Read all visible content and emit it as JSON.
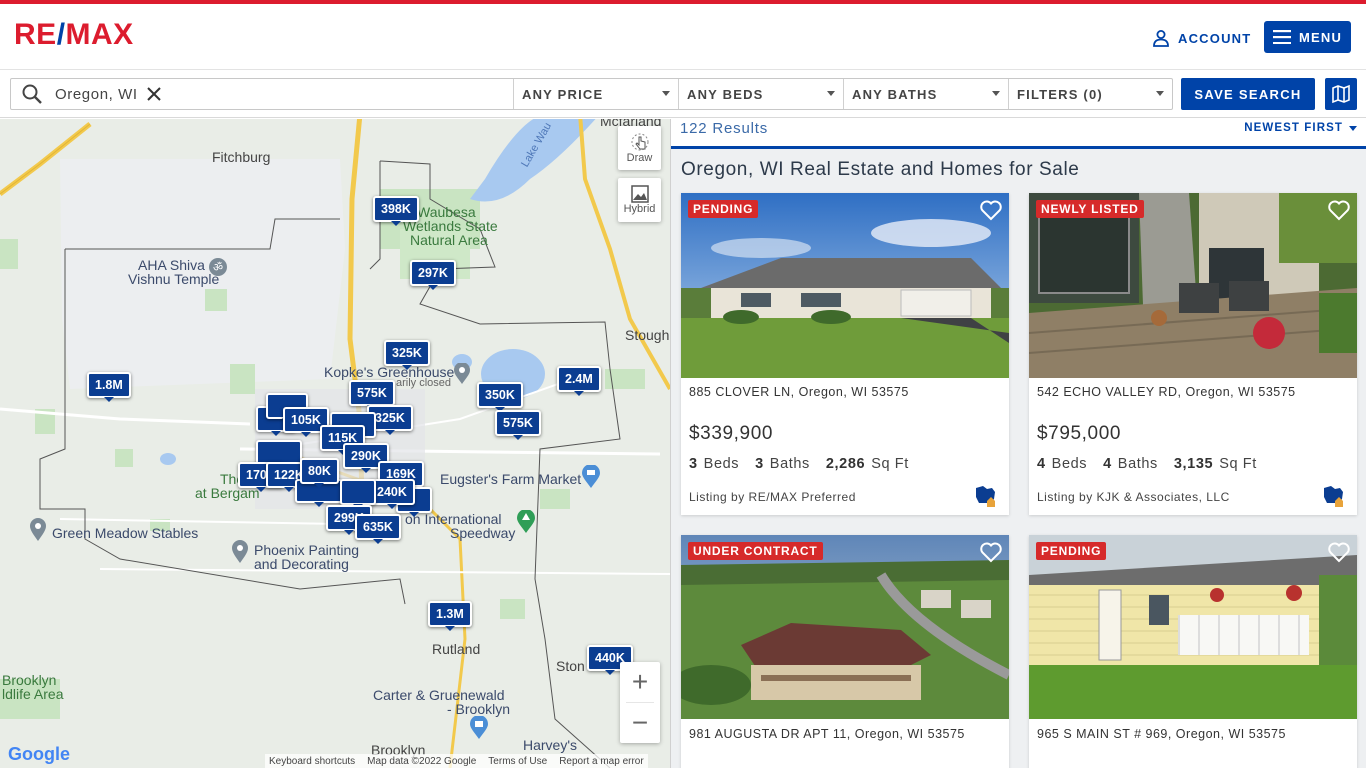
{
  "brand": {
    "logo_left": "RE",
    "logo_slash": "/",
    "logo_right": "MAX",
    "accent": "#dc1c2e",
    "primary": "#0043a8"
  },
  "header": {
    "account_label": "ACCOUNT",
    "menu_label": "MENU"
  },
  "search": {
    "location_value": "Oregon, WI",
    "price_label": "ANY PRICE",
    "beds_label": "ANY BEDS",
    "baths_label": "ANY BATHS",
    "filters_label": "FILTERS (0)",
    "save_search_label": "SAVE SEARCH"
  },
  "map": {
    "controls": {
      "draw_label": "Draw",
      "hybrid_label": "Hybrid"
    },
    "places": {
      "fitchburg": "Fitchburg",
      "waubesa": "Waubesa Wetlands State Natural Area",
      "waubesa_l1": "Waubesa",
      "waubesa_l2": "Wetlands State",
      "waubesa_l3": "Natural Area",
      "ahashiva_l1": "AHA Shiva",
      "ahashiva_l2": "Vishnu Temple",
      "kopkes": "Kopke's Greenhouse",
      "kopkes_sub": "arily closed",
      "eugsters": "Eugster's Farm Market",
      "speedway_l1": "on International",
      "speedway_l2": "Speedway",
      "green_meadow": "Green Meadow Stables",
      "phoenix_l1": "Phoenix Painting",
      "phoenix_l2": "and Decorating",
      "rutland": "Rutland",
      "carter_l1": "Carter & Gruenewald",
      "carter_l2": "- Brooklyn",
      "brooklyn": "Brooklyn",
      "brooklyn_wl_l1": "Brooklyn",
      "brooklyn_wl_l2": "ldlife Area",
      "harveys": "Harvey's",
      "stough": "Stough",
      "ston": "Ston",
      "mcfarland": "Mcfarland",
      "lake": "Lake Wau",
      "the_le": "The Le",
      "at_berga": "at Bergam"
    },
    "pins": [
      "398K",
      "297K",
      "325K",
      "1.8M",
      "575K",
      "325K",
      "350K",
      "2.4M",
      "575K",
      "105K",
      "115K",
      "290K",
      "169K",
      "170K",
      "122K",
      "80K",
      "240K",
      "299K",
      "635K",
      "1.3M",
      "440K"
    ],
    "footer": {
      "shortcuts": "Keyboard shortcuts",
      "mapdata": "Map data ©2022 Google",
      "terms": "Terms of Use",
      "report": "Report a map error"
    },
    "google": "Google"
  },
  "results": {
    "count": "122 Results",
    "sort_label": "NEWEST FIRST",
    "title": "Oregon, WI Real Estate and Homes for Sale",
    "cards": [
      {
        "badge": "PENDING",
        "address": "885 CLOVER LN, Oregon, WI 53575",
        "price": "$339,900",
        "beds": "3",
        "beds_label": "Beds",
        "baths": "3",
        "baths_label": "Baths",
        "sqft": "2,286",
        "sqft_label": "Sq Ft",
        "broker": "Listing by RE/MAX Preferred"
      },
      {
        "badge": "NEWLY LISTED",
        "address": "542 ECHO VALLEY RD, Oregon, WI 53575",
        "price": "$795,000",
        "beds": "4",
        "beds_label": "Beds",
        "baths": "4",
        "baths_label": "Baths",
        "sqft": "3,135",
        "sqft_label": "Sq Ft",
        "broker": "Listing by KJK & Associates, LLC"
      },
      {
        "badge": "UNDER CONTRACT",
        "address": "981 AUGUSTA DR APT 11, Oregon, WI 53575"
      },
      {
        "badge": "PENDING",
        "address": "965 S MAIN ST # 969, Oregon, WI 53575"
      }
    ]
  }
}
